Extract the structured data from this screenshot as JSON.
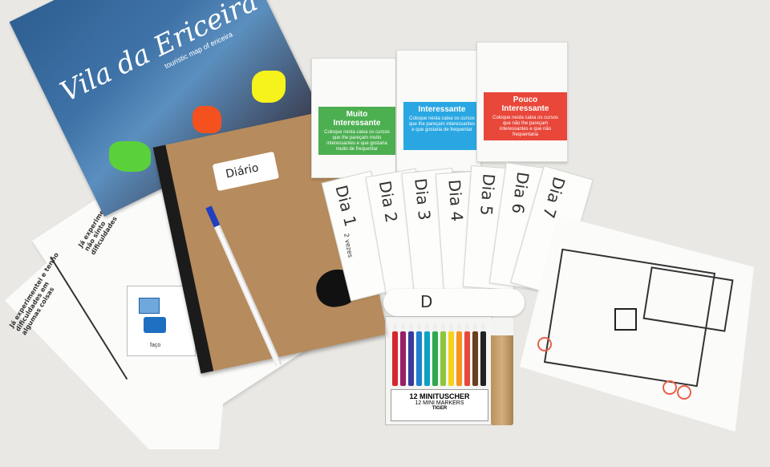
{
  "map": {
    "title": "Vila da Ericeira",
    "subtitle": "touristic map of ericeira"
  },
  "notebook": {
    "label": "Diário"
  },
  "boxes": [
    {
      "title": "Muito Interessante",
      "desc": "Coloque nesta caixa os cursos que lhe pareçam muito interessantes e que gostaria muito de frequentar",
      "color": "#4caf50"
    },
    {
      "title": "Interessante",
      "desc": "Coloque nesta caixa os cursos que lhe pareçam interessantes e que gostaria de frequentar",
      "color": "#2aa7e2"
    },
    {
      "title": "Pouco Interessante",
      "desc": "Coloque nesta caixa os cursos que não lhe pareçam interessantes e que não frequentaria",
      "color": "#e8473a"
    }
  ],
  "slips": [
    "Dia 1",
    "Dia 2",
    "Dia 3",
    "Dia 4",
    "Dia 5",
    "Dia 6",
    "Dia 7"
  ],
  "slip_note": "2 vezes",
  "rolled_slip": "D",
  "leaflet": {
    "left_text": "Já experimentei e tenho dificuldades em algumas coisas",
    "right_text": "Já experimentei e não sinto dificuldades",
    "card_caption": "faço"
  },
  "markers": {
    "title": "12 MINITUSCHER",
    "subtitle": "12 MINI MARKERS",
    "brand": "TIGER",
    "colors": [
      "#d7262e",
      "#9b1e6b",
      "#3a3a9e",
      "#1e7fd0",
      "#0aa3c2",
      "#2fa84f",
      "#8cc63f",
      "#f6d21c",
      "#f7941d",
      "#e8473a",
      "#6b3f1d",
      "#222222"
    ]
  }
}
